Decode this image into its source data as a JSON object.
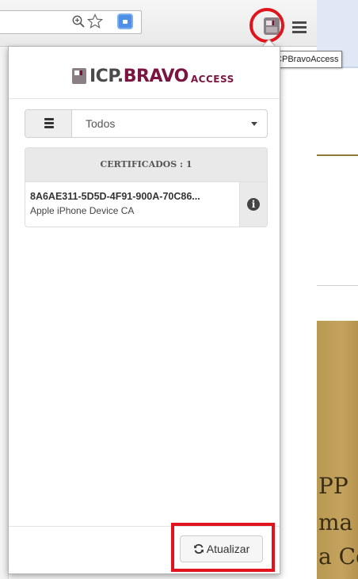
{
  "browser": {
    "tooltip": "ICPBravoAccess",
    "extension_icon": "icpbravo-extension-icon",
    "icons": [
      "zoom-icon",
      "star-icon",
      "extension-icon",
      "menu-icon"
    ],
    "highlight_color": "#e0141c"
  },
  "background_page": {
    "text_lines": [
      "PP",
      "ma",
      "a Co"
    ]
  },
  "popup": {
    "logo": {
      "part1": "ICP.",
      "part2": "BRAVO",
      "part3": "ACCESS"
    },
    "filter": {
      "icon": "server-icon",
      "selected": "Todos"
    },
    "certificates": {
      "header": "CERTIFICADOS : 1",
      "items": [
        {
          "id": "8A6AE311-5D5D-4F91-900A-70C86...",
          "issuer": "Apple iPhone Device CA",
          "action_icon": "info-icon"
        }
      ]
    },
    "refresh_button": {
      "label": "Atualizar",
      "icon": "refresh-icon"
    },
    "brand_color": "#7b1440"
  }
}
